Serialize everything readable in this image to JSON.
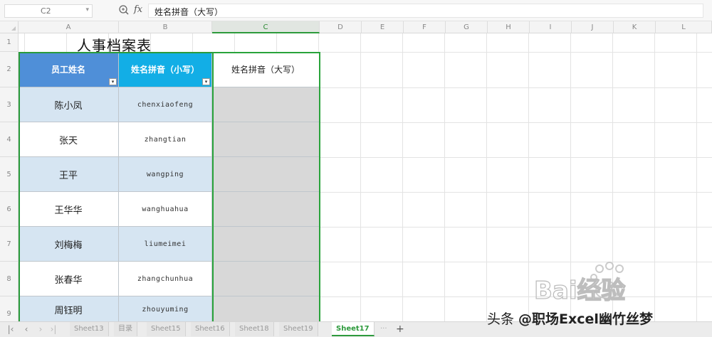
{
  "formula_bar": {
    "cell_ref": "C2",
    "fx_label": "fx",
    "formula": "姓名拼音（大写）"
  },
  "columns": [
    "A",
    "B",
    "C",
    "D",
    "E",
    "F",
    "G",
    "H",
    "I",
    "J",
    "K",
    "L"
  ],
  "rows": [
    "1",
    "2",
    "3",
    "4",
    "5",
    "6",
    "7",
    "8",
    "9"
  ],
  "sheet": {
    "title": "人事档案表",
    "headers": [
      "员工姓名",
      "姓名拼音（小写）",
      "姓名拼音（大写）"
    ],
    "records": [
      {
        "name": "陈小凤",
        "pinyin": "chenxiaofeng"
      },
      {
        "name": "张天",
        "pinyin": "zhangtian"
      },
      {
        "name": "王平",
        "pinyin": "wangping"
      },
      {
        "name": "王华华",
        "pinyin": "wanghuahua"
      },
      {
        "name": "刘梅梅",
        "pinyin": "liumeimei"
      },
      {
        "name": "张春华",
        "pinyin": "zhangchunhua"
      },
      {
        "name": "周钰明",
        "pinyin": "zhouyuming"
      }
    ],
    "filter_icon": "▾"
  },
  "tabs": {
    "labels": [
      "Sheet13",
      "目录",
      "Sheet15",
      "Sheet16",
      "Sheet18",
      "Sheet19",
      "Sheet17"
    ],
    "active": "Sheet17",
    "more": "···",
    "add": "+"
  },
  "watermark": {
    "baidu": "Bai经验",
    "credit_prefix": "头条 ",
    "credit": "@职场Excel幽竹丝梦"
  },
  "colors": {
    "header_a": "#4f8fd8",
    "header_b": "#12aee6",
    "row_blue": "#d6e5f2",
    "selection": "#29a33b"
  }
}
